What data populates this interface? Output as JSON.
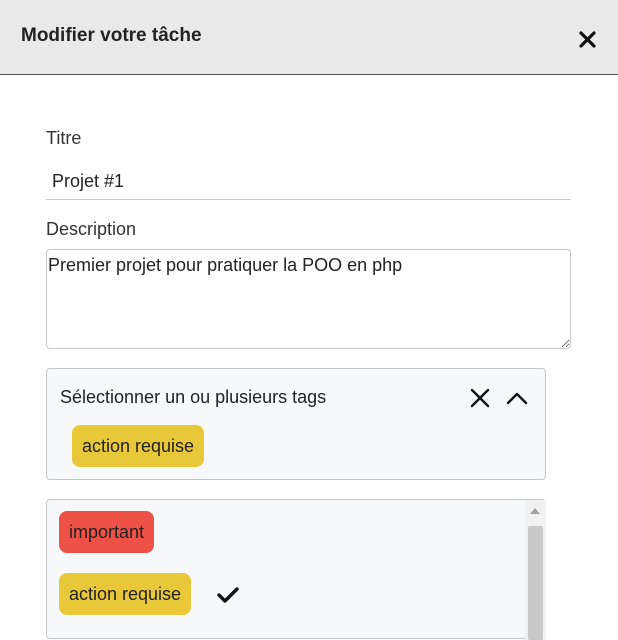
{
  "modal": {
    "title": "Modifier votre tâche"
  },
  "form": {
    "title_label": "Titre",
    "title_value": "Projet #1",
    "description_label": "Description",
    "description_value": "Premier projet pour pratiquer la POO en php"
  },
  "tags": {
    "placeholder": "Sélectionner un ou plusieurs tags",
    "selected": [
      {
        "label": "action requise",
        "color": "#e8c838"
      }
    ],
    "options": [
      {
        "label": "important",
        "color": "#ee5145",
        "checked": false
      },
      {
        "label": "action requise",
        "color": "#e8c838",
        "checked": true
      }
    ]
  },
  "icons": {
    "close": "close-icon",
    "clear": "clear-icon",
    "collapse": "chevron-up-icon",
    "check": "check-icon"
  }
}
